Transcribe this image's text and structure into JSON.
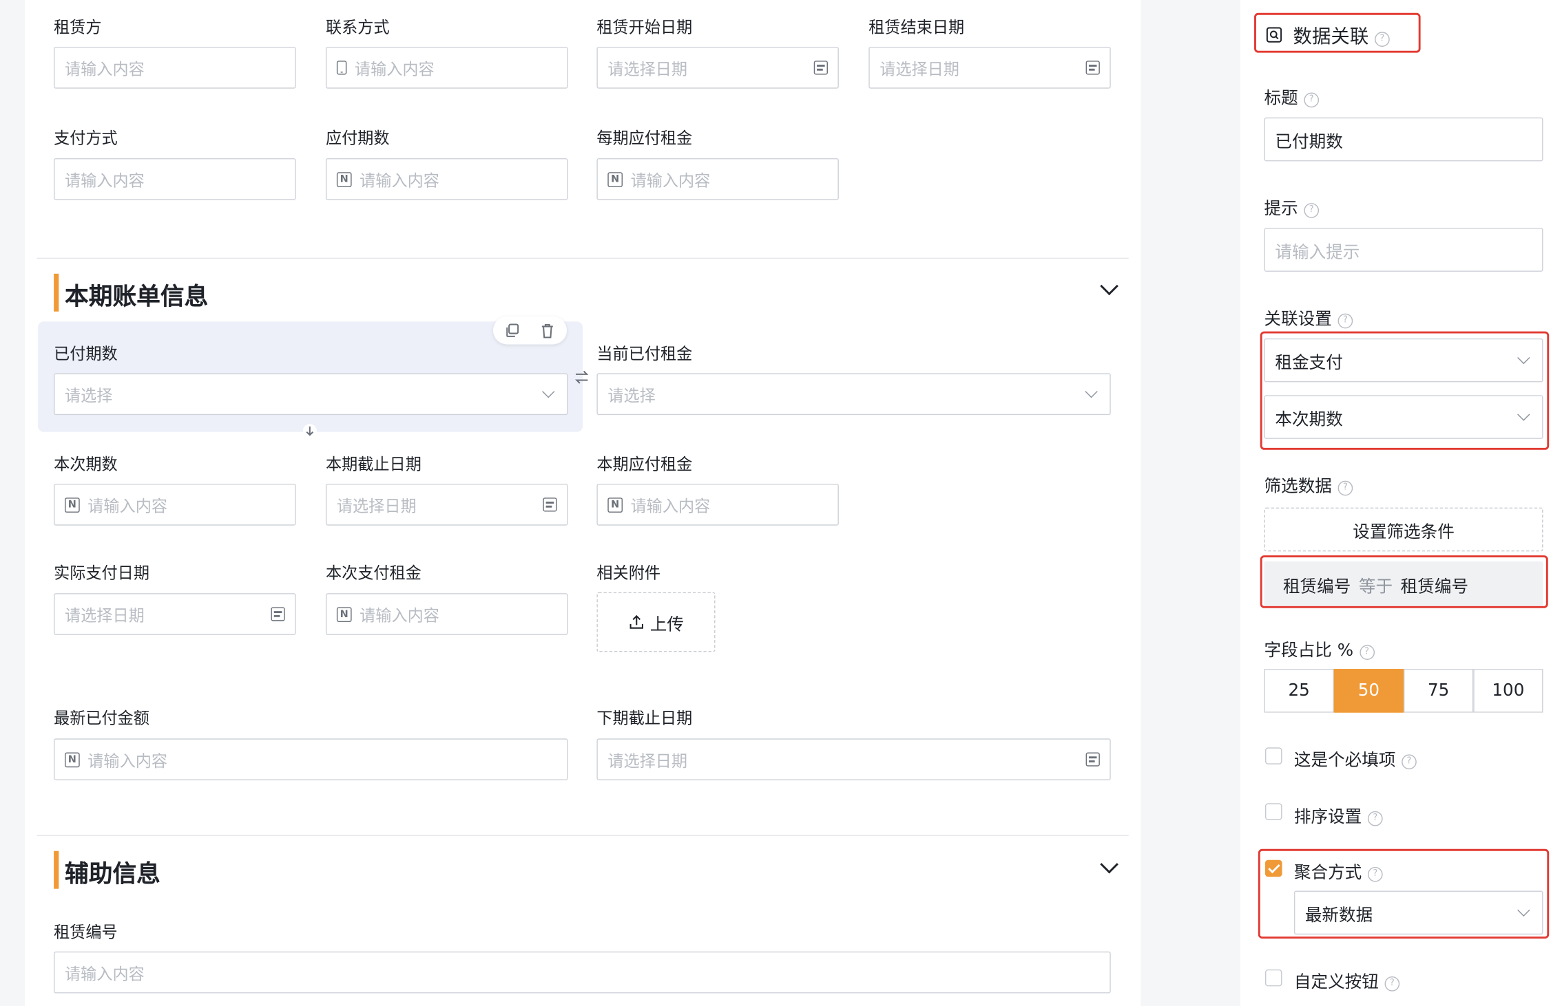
{
  "form": {
    "rows": {
      "lessor": {
        "label": "租赁方",
        "placeholder": "请输入内容"
      },
      "contact": {
        "label": "联系方式",
        "placeholder": "请输入内容"
      },
      "lease_start": {
        "label": "租赁开始日期",
        "placeholder": "请选择日期"
      },
      "lease_end": {
        "label": "租赁结束日期",
        "placeholder": "请选择日期"
      },
      "payment_method": {
        "label": "支付方式",
        "placeholder": "请输入内容"
      },
      "installments_due": {
        "label": "应付期数",
        "placeholder": "请输入内容"
      },
      "rent_per_period": {
        "label": "每期应付租金",
        "placeholder": "请输入内容"
      }
    },
    "section_bill": {
      "title": "本期账单信息",
      "paid_periods": {
        "label": "已付期数",
        "placeholder": "请选择"
      },
      "current_paid_rent": {
        "label": "当前已付租金",
        "placeholder": "请选择"
      },
      "this_period_number": {
        "label": "本次期数",
        "placeholder": "请输入内容"
      },
      "period_deadline": {
        "label": "本期截止日期",
        "placeholder": "请选择日期"
      },
      "period_rent_due": {
        "label": "本期应付租金",
        "placeholder": "请输入内容"
      },
      "actual_pay_date": {
        "label": "实际支付日期",
        "placeholder": "请选择日期"
      },
      "this_payment_rent": {
        "label": "本次支付租金",
        "placeholder": "请输入内容"
      },
      "attachments": {
        "label": "相关附件",
        "upload_label": "上传"
      },
      "latest_paid_amount": {
        "label": "最新已付金额",
        "placeholder": "请输入内容"
      },
      "next_deadline": {
        "label": "下期截止日期",
        "placeholder": "请选择日期"
      }
    },
    "section_aux": {
      "title": "辅助信息",
      "lease_number": {
        "label": "租赁编号",
        "placeholder": "请输入内容"
      }
    }
  },
  "panel": {
    "title": "数据关联",
    "title_label": "标题",
    "title_value": "已付期数",
    "hint_label": "提示",
    "hint_placeholder": "请输入提示",
    "link_settings_label": "关联设置",
    "link_form": "租金支付",
    "link_field": "本次期数",
    "filter_label": "筛选数据",
    "filter_button": "设置筛选条件",
    "filter_rule": {
      "left": "租赁编号",
      "op": "等于",
      "right": "租赁编号"
    },
    "width_label": "字段占比 %",
    "width_options": [
      "25",
      "50",
      "75",
      "100"
    ],
    "width_selected": "50",
    "required_label": "这是个必填项",
    "sort_label": "排序设置",
    "aggregate_label": "聚合方式",
    "aggregate_value": "最新数据",
    "custom_button_label": "自定义按钮",
    "accent_color": "#f09a37",
    "highlight_color": "#e23a32"
  }
}
